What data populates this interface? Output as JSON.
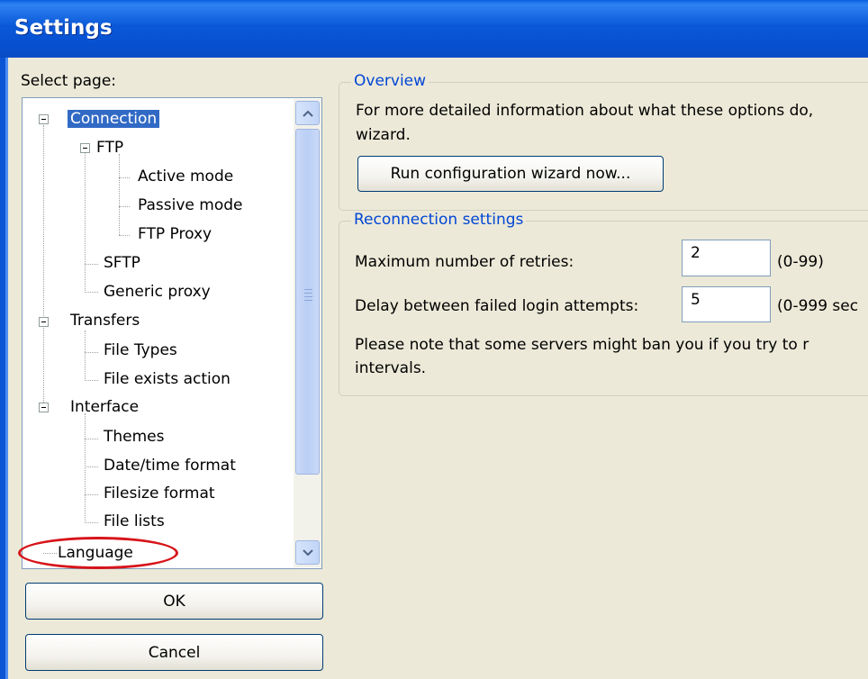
{
  "window": {
    "title": "Settings"
  },
  "tree": {
    "label": "Select page:",
    "items": [
      "Connection",
      "FTP",
      "Active mode",
      "Passive mode",
      "FTP Proxy",
      "SFTP",
      "Generic proxy",
      "Transfers",
      "File Types",
      "File exists action",
      "Interface",
      "Themes",
      "Date/time format",
      "Filesize format",
      "File lists",
      "Language"
    ]
  },
  "buttons": {
    "ok": "OK",
    "cancel": "Cancel",
    "wizard": "Run configuration wizard now..."
  },
  "overview": {
    "legend": "Overview",
    "line1": "For more detailed information about what these options do,",
    "line2": "wizard."
  },
  "reconnection": {
    "legend": "Reconnection settings",
    "retries_label": "Maximum number of retries:",
    "retries_value": "2",
    "retries_range": "(0-99)",
    "delay_label": "Delay between failed login attempts:",
    "delay_value": "5",
    "delay_range": "(0-999 sec",
    "note_line1": "Please note that some servers might ban you if you try to r",
    "note_line2": "intervals."
  },
  "colors": {
    "titlebar": "#0a58d8",
    "selection": "#316ac5",
    "legend": "#0046d5",
    "annotation": "#d7141a"
  }
}
